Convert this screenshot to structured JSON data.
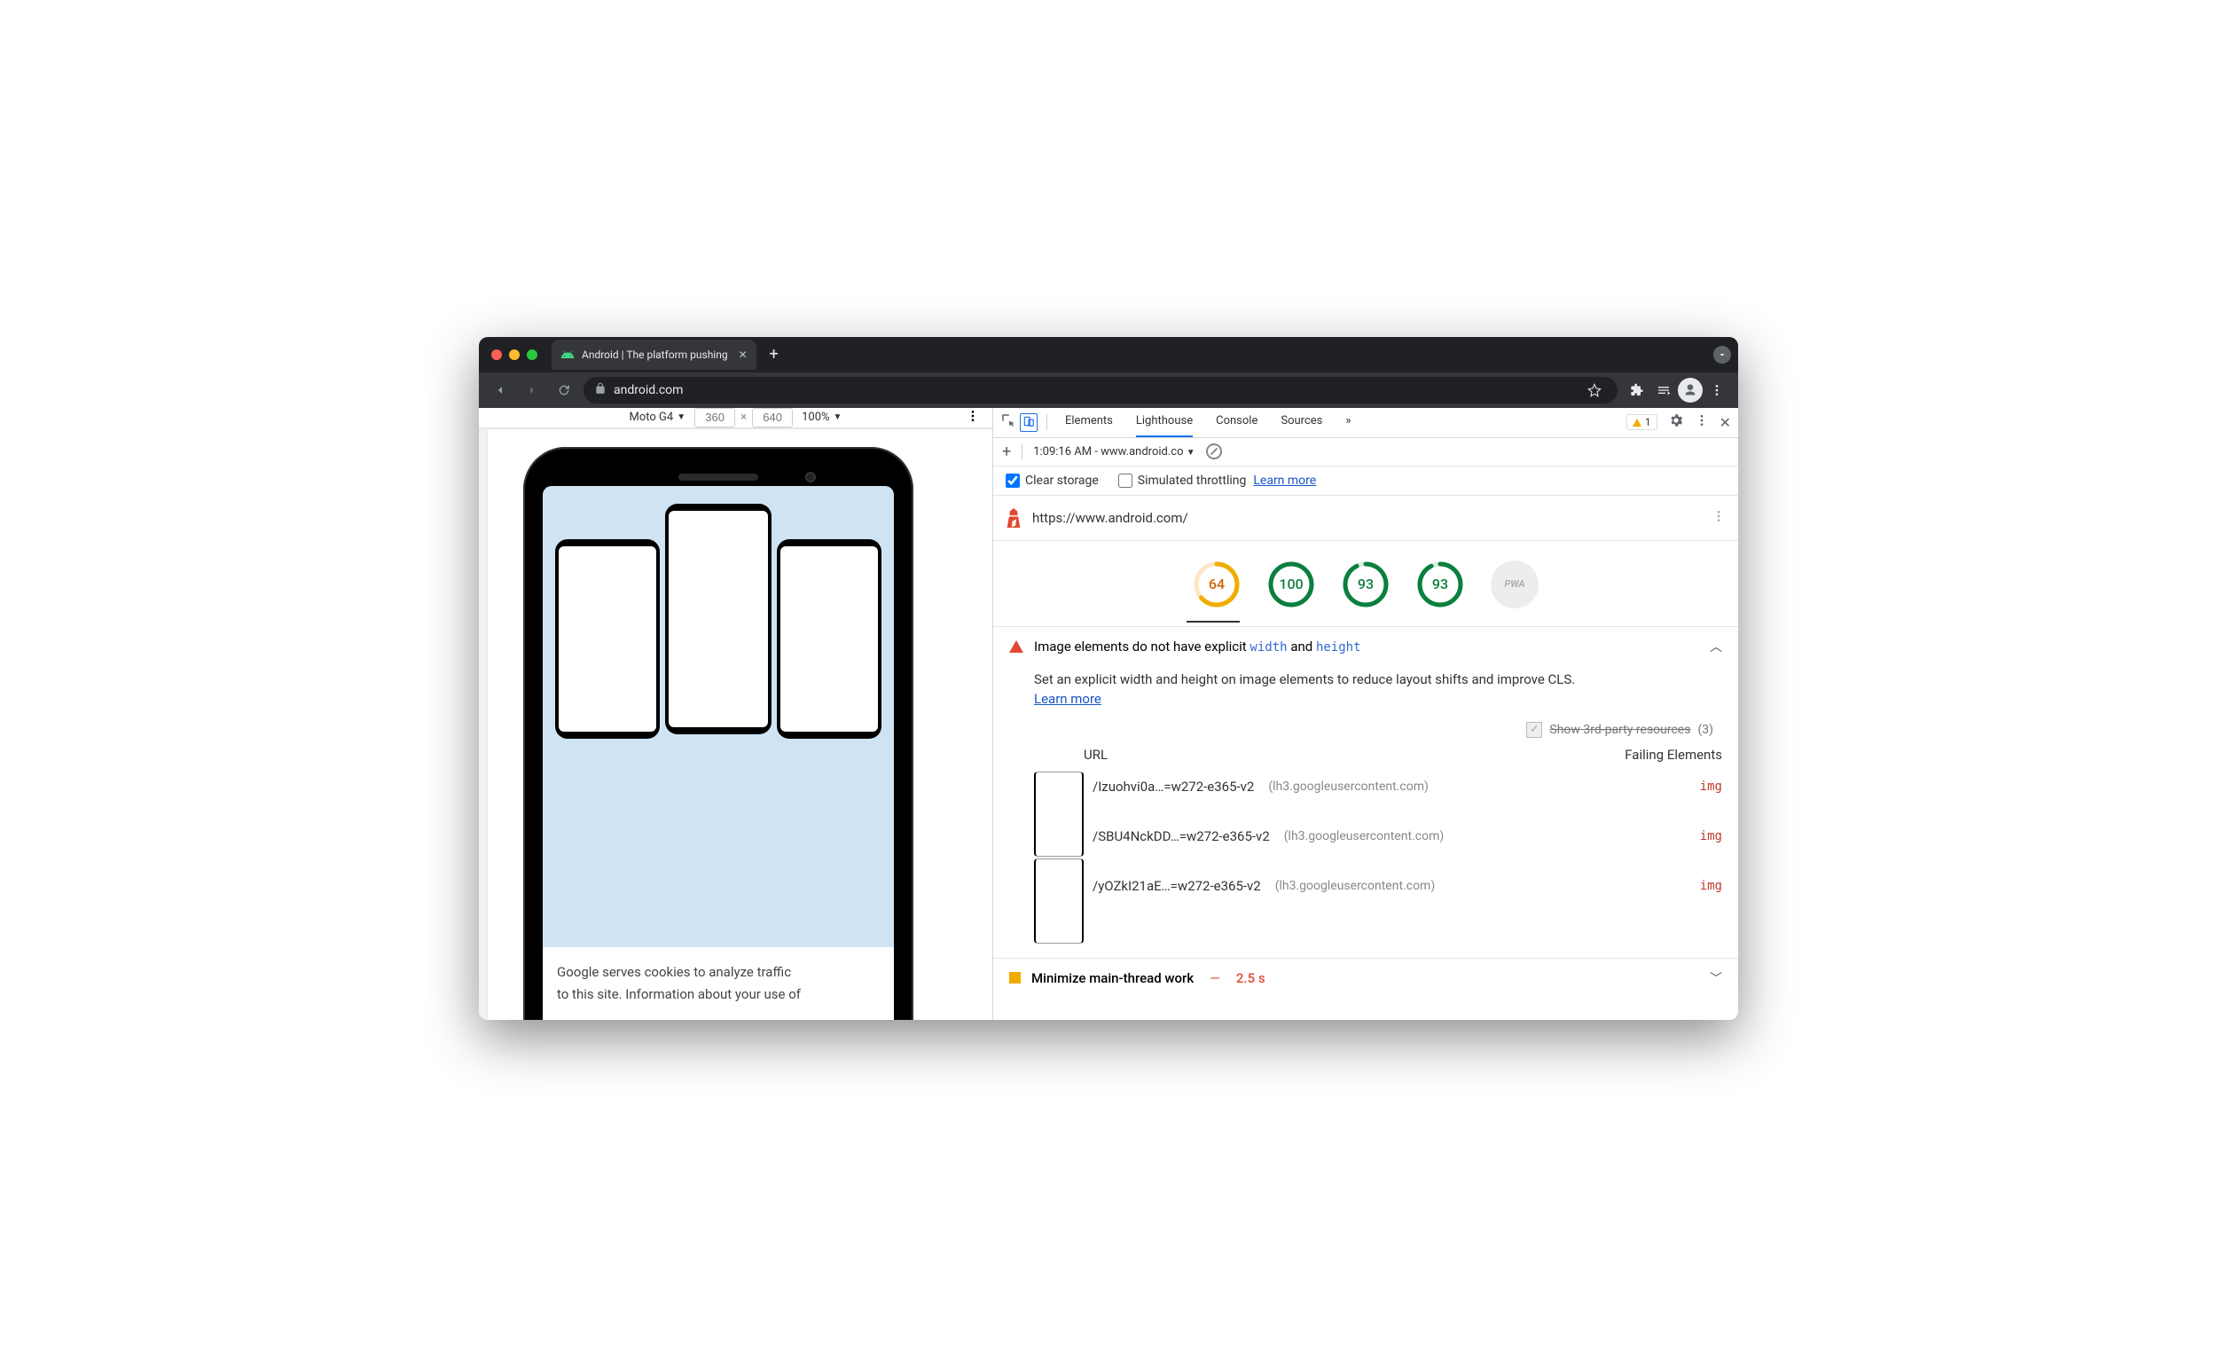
{
  "chrome": {
    "tab_title": "Android | The platform pushing",
    "url_host": "android.com",
    "nav": {
      "back": "←",
      "forward": "→",
      "reload": "⟳"
    }
  },
  "device_bar": {
    "device": "Moto G4",
    "width": "360",
    "height": "640",
    "zoom": "100%"
  },
  "page": {
    "cookie_line1": "Google serves cookies to analyze traffic",
    "cookie_line2": "to this site. Information about your use of"
  },
  "devtools": {
    "tabs": [
      "Elements",
      "Lighthouse",
      "Console",
      "Sources"
    ],
    "more": "»",
    "warning_count": "1",
    "run_label": "1:09:16 AM - www.android.co",
    "clear_storage": "Clear storage",
    "sim_throttle": "Simulated throttling",
    "learn_more": "Learn more",
    "tested_url": "https://www.android.com/",
    "scores": {
      "perf": "64",
      "a11y": "100",
      "bp": "93",
      "seo": "93",
      "pwa": "PWA"
    },
    "audit1_prefix": "Image elements do not have explicit",
    "audit1_code1": "width",
    "audit1_mid": "and",
    "audit1_code2": "height",
    "audit1_desc": "Set an explicit width and height on image elements to reduce layout shifts and improve CLS.",
    "audit1_link": "Learn more",
    "third_party_label": "Show 3rd-party resources",
    "third_party_count": "(3)",
    "table": {
      "col_url": "URL",
      "col_fail": "Failing Elements",
      "rows": [
        {
          "path": "/Izuohvi0a…=w272-e365-v2",
          "host": "(lh3.googleusercontent.com)",
          "fail": "img"
        },
        {
          "path": "/SBU4NckDD…=w272-e365-v2",
          "host": "(lh3.googleusercontent.com)",
          "fail": "img"
        },
        {
          "path": "/yOZkI21aE…=w272-e365-v2",
          "host": "(lh3.googleusercontent.com)",
          "fail": "img"
        }
      ]
    },
    "audit2_title": "Minimize main-thread work",
    "audit2_metric": "2.5 s"
  }
}
